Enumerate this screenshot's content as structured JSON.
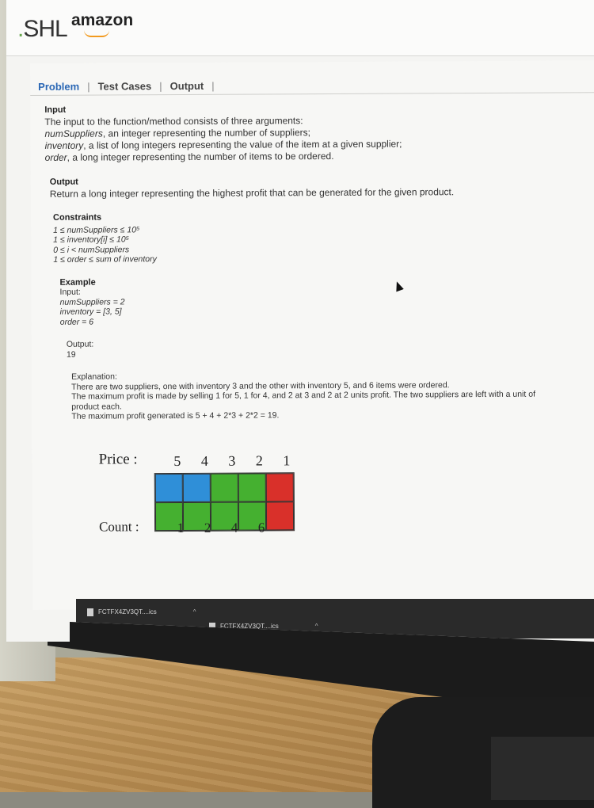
{
  "header": {
    "logo_shl": "SHL",
    "logo_amazon": "amazon"
  },
  "tabs": [
    {
      "label": "Problem",
      "active": true
    },
    {
      "label": "Test Cases",
      "active": false
    },
    {
      "label": "Output",
      "active": false
    }
  ],
  "input_section": {
    "heading": "Input",
    "intro": "The input to the function/method consists of three arguments:",
    "args": [
      {
        "name": "numSuppliers",
        "desc": ", an integer representing the number of suppliers;"
      },
      {
        "name": "inventory",
        "desc": ", a list of long integers representing the value of the item at a given supplier;"
      },
      {
        "name": "order",
        "desc": ", a long integer representing the number of items to be ordered."
      }
    ]
  },
  "output_section": {
    "heading": "Output",
    "text": "Return a long integer representing the highest profit that can be generated for the given product."
  },
  "constraints": {
    "heading": "Constraints",
    "lines": [
      "1 ≤ numSuppliers ≤ 10⁵",
      "1 ≤ inventory[i] ≤ 10⁵",
      "0 ≤ i < numSuppliers",
      "1 ≤ order ≤ sum of inventory"
    ]
  },
  "example": {
    "heading": "Example",
    "input_label": "Input:",
    "input_lines": [
      "numSuppliers = 2",
      "inventory = [3, 5]",
      "order = 6"
    ],
    "output_label": "Output:",
    "output_value": "19",
    "explanation_label": "Explanation:",
    "explanation_lines": [
      "There are two suppliers, one with inventory 3 and the other with inventory 5, and 6 items were ordered.",
      "The maximum profit is made by selling 1 for 5, 1 for 4, and 2 at 3 and 2 at 2 units profit. The two suppliers are left with a unit of",
      "product each.",
      "The maximum profit generated is 5 + 4 + 2*3 + 2*2 = 19."
    ]
  },
  "diagram": {
    "price_label": "Price :",
    "prices": [
      "5",
      "4",
      "3",
      "2",
      "1"
    ],
    "count_label": "Count :",
    "counts": [
      "1",
      "2",
      "4",
      "6"
    ],
    "colors": {
      "blue": "#2f8fd8",
      "green": "#45b030",
      "red": "#d9302a"
    },
    "rows": [
      [
        "blue",
        "blue",
        "green",
        "green",
        "red"
      ],
      [
        "green",
        "green",
        "green",
        "green",
        "red"
      ]
    ]
  },
  "downloads": [
    {
      "filename": "FCTFX4ZV3QT....ics"
    },
    {
      "filename": "FCTFX4ZV3QT....ics"
    }
  ]
}
